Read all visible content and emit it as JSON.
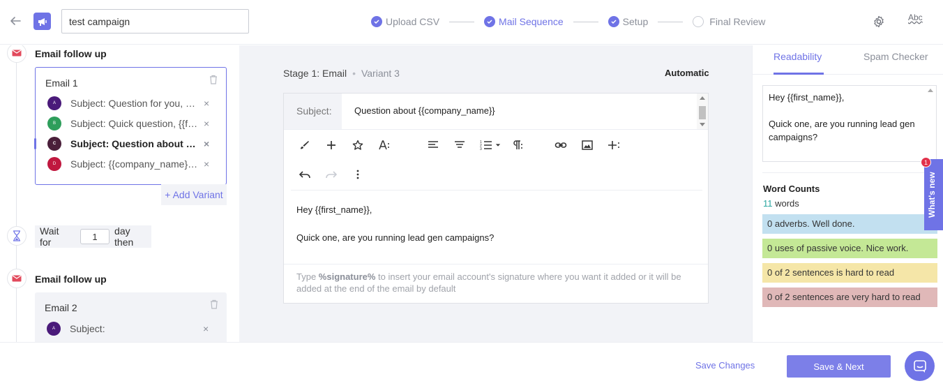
{
  "header": {
    "campaign_name": "test campaign",
    "steps": [
      {
        "label": "Upload CSV",
        "state": "done"
      },
      {
        "label": "Mail Sequence",
        "state": "active"
      },
      {
        "label": "Setup",
        "state": "done"
      },
      {
        "label": "Final Review",
        "state": "pending"
      }
    ],
    "spellcheck_label": "Abc"
  },
  "sequence": {
    "section1_title": "Email follow up",
    "email1": {
      "title": "Email 1",
      "variants": [
        {
          "badge": "A",
          "subject": "Subject: Question for you, {{first_name}}",
          "color": "#4a1a7a"
        },
        {
          "badge": "B",
          "subject": "Subject: Quick question, {{first_name}}",
          "color": "#2e9e5b"
        },
        {
          "badge": "C",
          "subject": "Subject: Question about {{company_name}}",
          "color": "#4a1f3a"
        },
        {
          "badge": "D",
          "subject": "Subject: {{company_name}} question",
          "color": "#c0183f"
        }
      ]
    },
    "add_variant_label": "+ Add Variant",
    "wait": {
      "prefix": "Wait for",
      "value": "1",
      "suffix": "day then"
    },
    "section2_title": "Email follow up",
    "email2": {
      "title": "Email 2",
      "variants": [
        {
          "badge": "A",
          "subject": "Subject:",
          "color": "#4a1a7a"
        }
      ]
    }
  },
  "editor": {
    "stage_label": "Stage 1: Email",
    "variant_label": "Variant 3",
    "mode_label": "Automatic",
    "subject_label": "Subject:",
    "subject_value": "Question about {{company_name}}",
    "body_line1": "Hey {{first_name}},",
    "body_line2": "Quick one, are you running lead gen campaigns?",
    "signature_prefix": "Type ",
    "signature_token": "%signature%",
    "signature_suffix": " to insert your email account's signature where you want it added or it will be added at the end of the email by default"
  },
  "right_panel": {
    "tab_readability": "Readability",
    "tab_spam": "Spam Checker",
    "preview_line1": "Hey {{first_name}},",
    "preview_line2": "Quick one, are you running lead gen campaigns?",
    "word_counts_title": "Word Counts",
    "word_count": "11",
    "word_count_suffix": " words",
    "stats": [
      {
        "text": "0 adverbs. Well done.",
        "color": "#c2e0f0"
      },
      {
        "text": "0 uses of passive voice. Nice work.",
        "color": "#c4e896"
      },
      {
        "text": "0 of 2 sentences is hard to read",
        "color": "#f5e6a8"
      },
      {
        "text": "0 of 2 sentences are very hard to read",
        "color": "#e0b8b8"
      }
    ],
    "whats_new_label": "What's new",
    "whats_new_badge": "1"
  },
  "footer": {
    "save_changes": "Save Changes",
    "save_next": "Save & Next"
  },
  "colors": {
    "accent": "#6f73e6",
    "panel_bg": "#f2f3f7"
  }
}
